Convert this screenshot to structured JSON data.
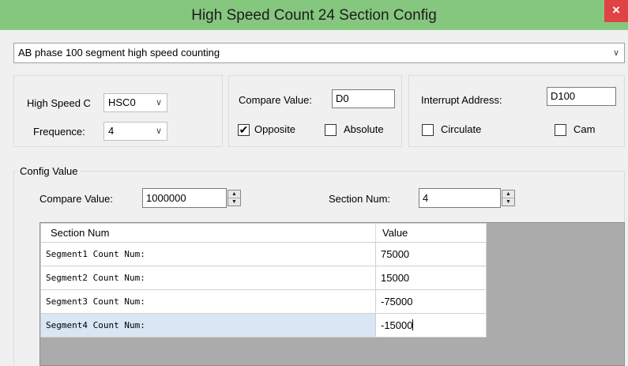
{
  "window": {
    "title": "High Speed Count 24 Section Config",
    "close_label": "×"
  },
  "mode_select": {
    "value": "AB phase 100 segment high speed counting",
    "arrow": "∨"
  },
  "counter_group": {
    "counter_label": "High Speed C",
    "counter_value": "HSC0",
    "frequence_label": "Frequence:",
    "frequence_value": "4",
    "arrow": "∨"
  },
  "compare_group": {
    "compare_label": "Compare Value:",
    "compare_value": "D0",
    "opposite_label": "Opposite",
    "opposite_checked": true,
    "absolute_label": "Absolute",
    "absolute_checked": false,
    "check_mark": "✔"
  },
  "interrupt_group": {
    "interrupt_label": "Interrupt Address:",
    "interrupt_value": "D100",
    "circulate_label": "Circulate",
    "circulate_checked": false,
    "cam_label": "Cam",
    "cam_checked": false
  },
  "config_value": {
    "group_title": "Config Value",
    "compare_label": "Compare Value:",
    "compare_value": "1000000",
    "section_label": "Section Num:",
    "section_value": "4",
    "spin_up": "▲",
    "spin_down": "▼"
  },
  "grid": {
    "columns": [
      "Section Num",
      "Value"
    ],
    "rows": [
      {
        "name": "Segment1 Count Num:",
        "value": "75000"
      },
      {
        "name": "Segment2 Count Num:",
        "value": "15000"
      },
      {
        "name": "Segment3 Count Num:",
        "value": "-75000"
      },
      {
        "name": "Segment4 Count Num:",
        "value": "-15000"
      }
    ],
    "selected_row_index": 3
  }
}
